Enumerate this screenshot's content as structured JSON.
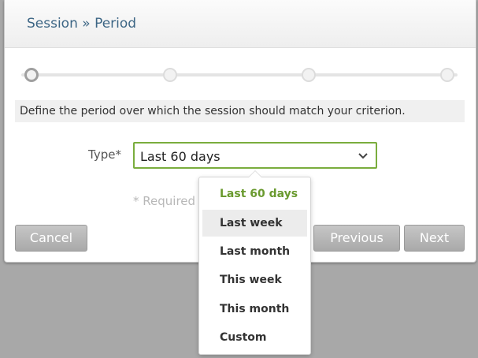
{
  "dialog": {
    "title": "Session » Period",
    "info_text": "Define the period over which the session should match your criterion.",
    "type_label": "Type*",
    "type_value": "Last 60 days",
    "required_note": "* Required"
  },
  "steps": {
    "total": 4,
    "current": 1
  },
  "dropdown": {
    "options": [
      "Last 60 days",
      "Last week",
      "Last month",
      "This week",
      "This month",
      "Custom"
    ],
    "selected": "Last 60 days",
    "hovered": "Last week"
  },
  "buttons": {
    "cancel": "Cancel",
    "previous": "Previous",
    "next": "Next"
  },
  "colors": {
    "title": "#3d6685",
    "accent_green": "#7aad3d",
    "selected_option": "#6a9a2f",
    "button": "#b5b5b5",
    "overlay": "#a8a8a8"
  }
}
